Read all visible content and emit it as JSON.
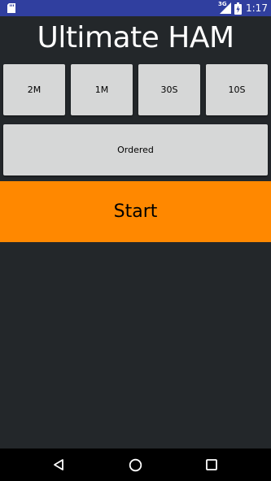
{
  "status_bar": {
    "time": "1:17",
    "network": "3G",
    "icons": [
      "sd-card-icon",
      "signal-icon",
      "battery-icon"
    ]
  },
  "app": {
    "title": "Ultimate HAM"
  },
  "duration_buttons": [
    {
      "label": "2M"
    },
    {
      "label": "1M"
    },
    {
      "label": "30S"
    },
    {
      "label": "10S"
    }
  ],
  "mode_button": {
    "label": "Ordered"
  },
  "start_button": {
    "label": "Start"
  },
  "colors": {
    "status_bar": "#303f9f",
    "background": "#23272a",
    "button": "#d6d7d7",
    "accent": "#ff8800",
    "nav_bar": "#000000"
  },
  "nav_bar": {
    "icons": [
      "back-icon",
      "home-icon",
      "recents-icon"
    ]
  }
}
